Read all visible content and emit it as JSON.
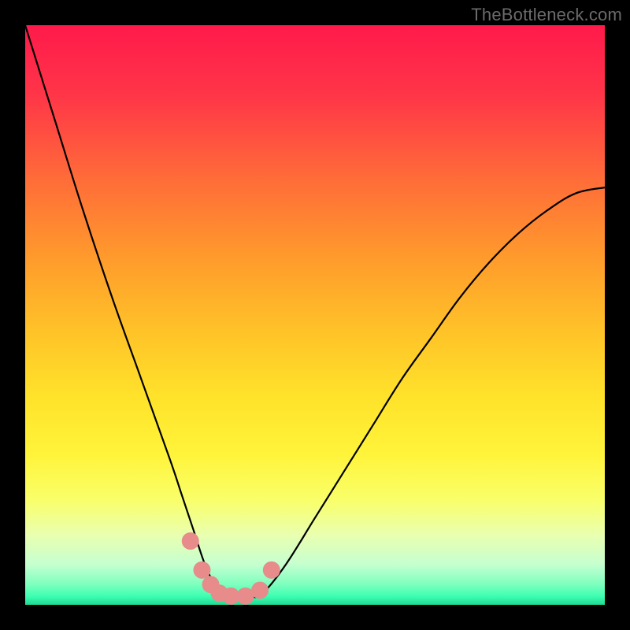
{
  "watermark": "TheBottleneck.com",
  "chart_data": {
    "type": "line",
    "title": "",
    "xlabel": "",
    "ylabel": "",
    "xlim": [
      0,
      100
    ],
    "ylim": [
      0,
      100
    ],
    "grid": false,
    "legend": false,
    "series": [
      {
        "name": "curve",
        "color": "#000000",
        "x": [
          0,
          5,
          10,
          15,
          20,
          25,
          27,
          29,
          31,
          33,
          35,
          37,
          39,
          41,
          45,
          50,
          55,
          60,
          65,
          70,
          75,
          80,
          85,
          90,
          95,
          100
        ],
        "y": [
          100,
          84,
          68,
          53,
          39,
          25,
          19,
          13,
          7,
          3,
          1.5,
          1.2,
          1.3,
          2,
          7,
          15,
          23,
          31,
          39,
          46,
          53,
          59,
          64,
          68,
          71,
          72
        ]
      },
      {
        "name": "highlight-dots",
        "color": "#e78b8b",
        "x": [
          28.5,
          30.5,
          32.0,
          33.5,
          35.5,
          38.0,
          40.5,
          42.5
        ],
        "y": [
          11.0,
          6.0,
          3.5,
          2.0,
          1.5,
          1.5,
          2.5,
          6.0
        ]
      }
    ],
    "background_gradient": {
      "stops": [
        {
          "offset": 0.0,
          "color": "#ff1a4b"
        },
        {
          "offset": 0.12,
          "color": "#ff3548"
        },
        {
          "offset": 0.26,
          "color": "#ff6a39"
        },
        {
          "offset": 0.4,
          "color": "#ff9a2c"
        },
        {
          "offset": 0.53,
          "color": "#ffc328"
        },
        {
          "offset": 0.64,
          "color": "#ffe22a"
        },
        {
          "offset": 0.74,
          "color": "#fff43a"
        },
        {
          "offset": 0.82,
          "color": "#f9ff6a"
        },
        {
          "offset": 0.88,
          "color": "#e9ffb0"
        },
        {
          "offset": 0.93,
          "color": "#c6ffd0"
        },
        {
          "offset": 0.965,
          "color": "#7dffbe"
        },
        {
          "offset": 0.985,
          "color": "#3dffb1"
        },
        {
          "offset": 1.0,
          "color": "#1fdb95"
        }
      ]
    }
  }
}
